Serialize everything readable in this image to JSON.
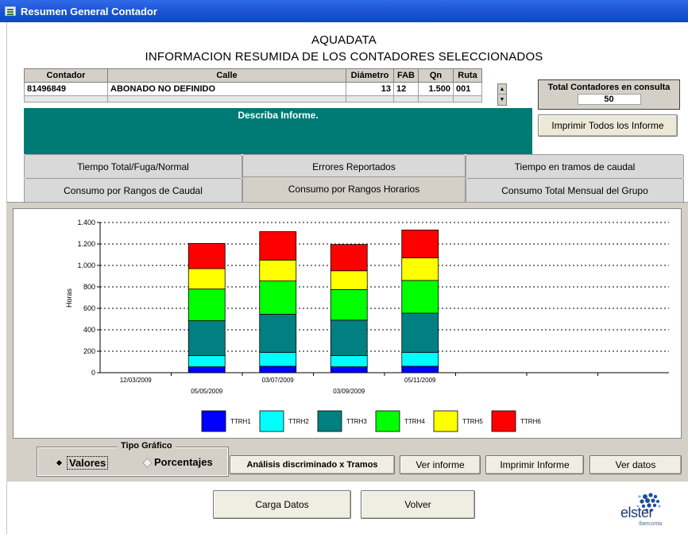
{
  "window": {
    "title": "Resumen General Contador"
  },
  "header": {
    "title": "AQUADATA",
    "subtitle": "INFORMACION RESUMIDA DE LOS CONTADORES SELECCIONADOS"
  },
  "table": {
    "columns": [
      "Contador",
      "Calle",
      "Diámetro",
      "FAB",
      "Qn",
      "Ruta"
    ],
    "rows": [
      [
        "81496849",
        "ABONADO NO DEFINIDO",
        "13",
        "12",
        "1.500",
        "001"
      ]
    ]
  },
  "total": {
    "label": "Total Contadores en consulta",
    "value": "50"
  },
  "print_all_label": "Imprimir Todos los Informe",
  "describe_label": "Describa Informe.",
  "tabs": {
    "row1": [
      "Tiempo Total/Fuga/Normal",
      "Errores Reportados",
      "Tiempo en tramos de caudal"
    ],
    "row2": [
      "Consumo por Rangos de Caudal",
      "Consumo por Rangos Horarios",
      "Consumo Total Mensual del Grupo"
    ],
    "active": "Consumo por Rangos Horarios"
  },
  "colors": {
    "TTRH1": "#0000ff",
    "TTRH2": "#00ffff",
    "TTRH3": "#008080",
    "TTRH4": "#00ff00",
    "TTRH5": "#ffff00",
    "TTRH6": "#ff0000",
    "teal_panel": "#007a74"
  },
  "chart_data": {
    "type": "bar",
    "stacked": true,
    "ylabel": "Horas",
    "ylim": [
      0,
      1400
    ],
    "yticks": [
      "0",
      "200",
      "400",
      "600",
      "800",
      "1.000",
      "1.200",
      "1.400"
    ],
    "xticks": [
      "12/03/2009",
      "05/05/2009",
      "03/07/2009",
      "03/09/2009",
      "05/11/2009"
    ],
    "grid": "horizontal dotted",
    "legend": "bottom",
    "series": [
      {
        "name": "TTRH1",
        "values": [
          0,
          55,
          60,
          55,
          60
        ]
      },
      {
        "name": "TTRH2",
        "values": [
          0,
          105,
          130,
          105,
          130
        ]
      },
      {
        "name": "TTRH3",
        "values": [
          0,
          325,
          355,
          330,
          365
        ]
      },
      {
        "name": "TTRH4",
        "values": [
          0,
          295,
          310,
          285,
          305
        ]
      },
      {
        "name": "TTRH5",
        "values": [
          0,
          190,
          195,
          175,
          210
        ]
      },
      {
        "name": "TTRH6",
        "values": [
          0,
          235,
          265,
          245,
          260
        ]
      }
    ]
  },
  "tipo_grafico": {
    "label": "Tipo Gráfico",
    "option_values": "Valores",
    "option_percent": "Porcentajes",
    "selected": "Valores"
  },
  "buttons": {
    "analysis": "Análisis discriminado x Tramos",
    "ver_informe": "Ver informe",
    "imprimir_informe": "Imprimir Informe",
    "ver_datos": "Ver datos",
    "carga_datos": "Carga Datos",
    "volver": "Volver"
  },
  "logo": {
    "name": "elster",
    "sub": "Iberconta"
  }
}
